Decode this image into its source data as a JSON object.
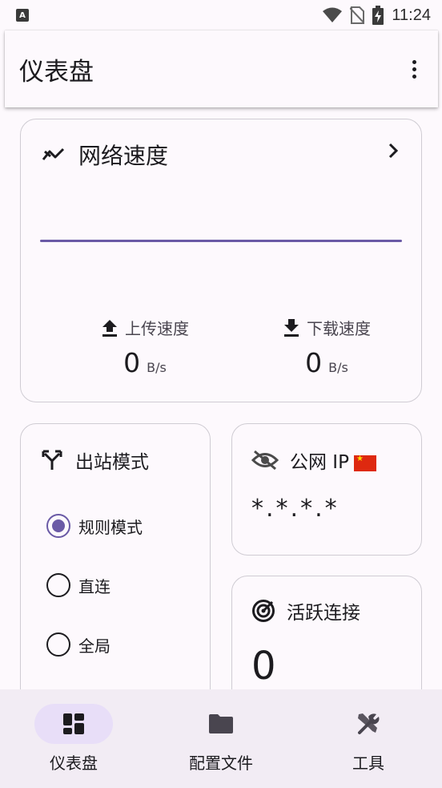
{
  "status_bar": {
    "time": "11:24"
  },
  "app_bar": {
    "title": "仪表盘"
  },
  "speed_card": {
    "title": "网络速度",
    "upload": {
      "label": "上传速度",
      "value": "0",
      "unit": "B/s"
    },
    "download": {
      "label": "下载速度",
      "value": "0",
      "unit": "B/s"
    }
  },
  "mode_card": {
    "title": "出站模式",
    "options": [
      {
        "label": "规则模式",
        "selected": true
      },
      {
        "label": "直连",
        "selected": false
      },
      {
        "label": "全局",
        "selected": false
      }
    ]
  },
  "ip_card": {
    "title": "公网 IP",
    "value": "*.*.*.*"
  },
  "conn_card": {
    "title": "活跃连接",
    "value": "0"
  },
  "bottom_nav": {
    "items": [
      {
        "label": "仪表盘",
        "icon": "dashboard-icon",
        "active": true
      },
      {
        "label": "配置文件",
        "icon": "folder-icon",
        "active": false
      },
      {
        "label": "工具",
        "icon": "tools-icon",
        "active": false
      }
    ]
  },
  "colors": {
    "accent": "#6a5aa6",
    "nav_active_bg": "#e8def8",
    "nav_bg": "#f2ecf4",
    "flag_red": "#de2910"
  }
}
